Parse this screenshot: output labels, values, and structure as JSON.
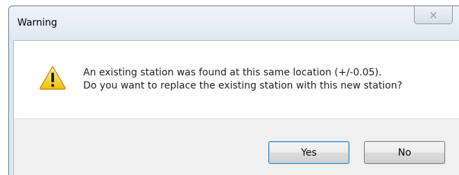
{
  "dialog": {
    "title": "Warning",
    "close_icon": "close-x-icon",
    "message_icon": "warning-triangle-icon",
    "message_lines": [
      "An existing station was found at this same location (+/-0.05).",
      "Do you want to replace the existing station with this new station?"
    ],
    "buttons": {
      "yes_label": "Yes",
      "no_label": "No"
    },
    "default_button": "yes"
  },
  "colors": {
    "title_bar": "#dfe8f3",
    "button_bar": "#f0f0f0",
    "warning_yellow": "#f7c600",
    "default_button_border": "#3c7fb1"
  }
}
